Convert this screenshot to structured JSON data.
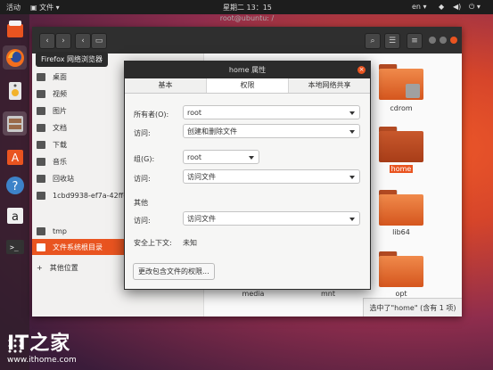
{
  "topbar": {
    "activities": "活动",
    "files_menu": "文件",
    "clock": "星期二 13：15",
    "lang": "en"
  },
  "launcher_tooltip": "Firefox 网络浏览器",
  "files_window": {
    "title": "root@ubuntu: /",
    "sidebar": [
      {
        "label": "桌面"
      },
      {
        "label": "视频"
      },
      {
        "label": "图片"
      },
      {
        "label": "文档"
      },
      {
        "label": "下载"
      },
      {
        "label": "音乐"
      },
      {
        "label": "回收站"
      },
      {
        "label": "1cbd9938-ef7a-42ff-a78"
      },
      {
        "label": "tmp"
      },
      {
        "label": "文件系统根目录"
      },
      {
        "label": "其他位置"
      }
    ],
    "folders": [
      "cdrom",
      "home",
      "lib64",
      "media",
      "mnt",
      "opt"
    ],
    "status": "选中了\"home\" (含有 1 项)"
  },
  "dialog": {
    "title": "home 属性",
    "tabs": [
      "基本",
      "权限",
      "本地网络共享"
    ],
    "owner_label": "所有者(O):",
    "owner_value": "root",
    "owner_access_label": "访问:",
    "owner_access_value": "创建和删除文件",
    "group_label": "组(G):",
    "group_value": "root",
    "group_access_label": "访问:",
    "group_access_value": "访问文件",
    "other_label": "其他",
    "other_access_label": "访问:",
    "other_access_value": "访问文件",
    "security_label": "安全上下文:",
    "security_value": "未知",
    "change_button": "更改包含文件的权限..."
  },
  "watermark": {
    "logo": "IT之家",
    "url": "www.ithome.com"
  }
}
